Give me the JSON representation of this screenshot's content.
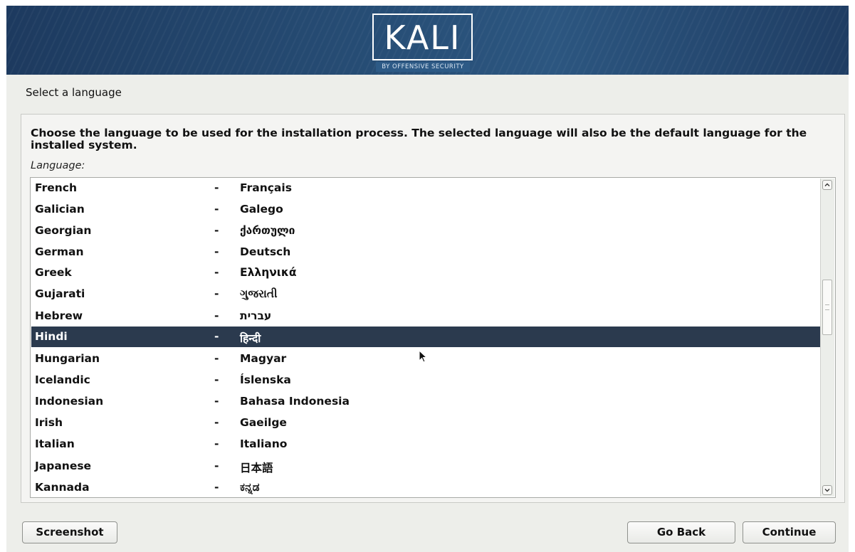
{
  "header": {
    "logo_text": "KALI",
    "logo_subtitle": "BY OFFENSIVE SECURITY",
    "colors": {
      "banner": "#274e76",
      "selection": "#2b3a4e"
    }
  },
  "page_title": "Select a language",
  "description": "Choose the language to be used for the installation process. The selected language will also be the default language for the installed system.",
  "language_label": "Language:",
  "languages": [
    {
      "name": "French",
      "dash": "-",
      "native": "Français"
    },
    {
      "name": "Galician",
      "dash": "-",
      "native": "Galego"
    },
    {
      "name": "Georgian",
      "dash": "-",
      "native": "ქართული"
    },
    {
      "name": "German",
      "dash": "-",
      "native": "Deutsch"
    },
    {
      "name": "Greek",
      "dash": "-",
      "native": "Ελληνικά"
    },
    {
      "name": "Gujarati",
      "dash": "-",
      "native": "ગુજરાતી"
    },
    {
      "name": "Hebrew",
      "dash": "-",
      "native": "עברית"
    },
    {
      "name": "Hindi",
      "dash": "-",
      "native": "हिन्दी",
      "selected": true
    },
    {
      "name": "Hungarian",
      "dash": "-",
      "native": "Magyar"
    },
    {
      "name": "Icelandic",
      "dash": "-",
      "native": "Íslenska"
    },
    {
      "name": "Indonesian",
      "dash": "-",
      "native": "Bahasa Indonesia"
    },
    {
      "name": "Irish",
      "dash": "-",
      "native": "Gaeilge"
    },
    {
      "name": "Italian",
      "dash": "-",
      "native": "Italiano"
    },
    {
      "name": "Japanese",
      "dash": "-",
      "native": "日本語"
    },
    {
      "name": "Kannada",
      "dash": "-",
      "native": "ಕನ್ನಡ"
    }
  ],
  "buttons": {
    "screenshot": "Screenshot",
    "go_back": "Go Back",
    "continue": "Continue"
  },
  "icons": {
    "scroll_up": "chevron-up-icon",
    "scroll_down": "chevron-down-icon",
    "cursor": "mouse-pointer-icon"
  }
}
